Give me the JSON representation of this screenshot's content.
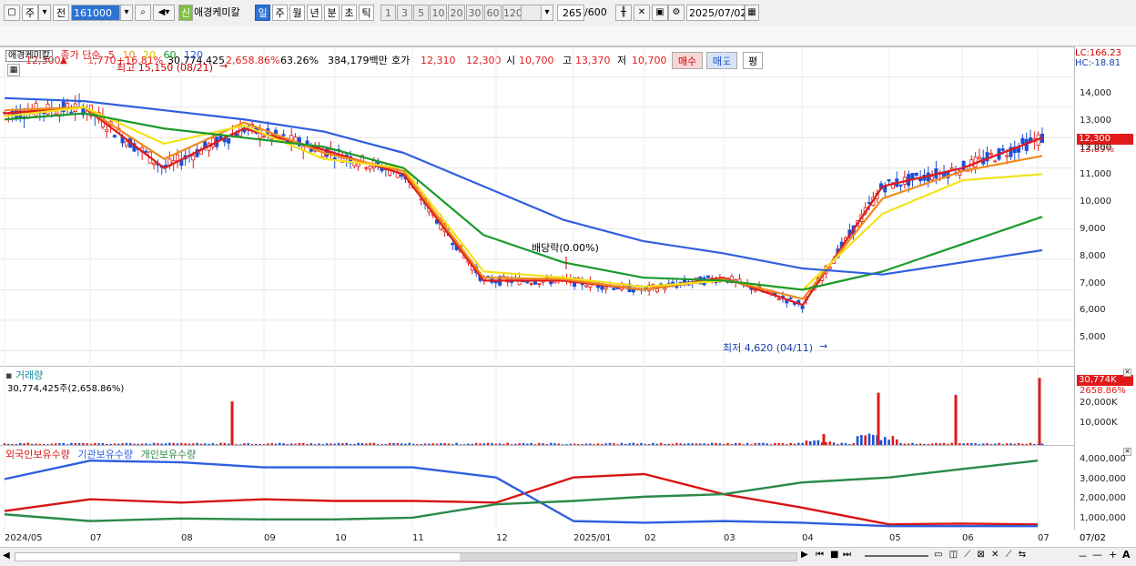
{
  "toolbar": {
    "stock_type": "주",
    "prev_label": "전",
    "code_value": "161000",
    "new_badge": "신",
    "stock_name": "애경케미칼",
    "periods": [
      "일",
      "주",
      "월",
      "년",
      "분",
      "초",
      "틱"
    ],
    "selected_period": "일",
    "minute_buttons": [
      "1",
      "3",
      "5",
      "10",
      "20",
      "30",
      "60",
      "120"
    ],
    "count_value": "265",
    "count_total": "/600",
    "date_value": "2025/07/02"
  },
  "quote": {
    "price": "12,300",
    "arrow": "▲",
    "change": "1,770",
    "change_pct": "+16.81%",
    "volume": "30,774,425",
    "volume_pct": "2,658.86%",
    "rate": "63.26%",
    "amount": "384,179백만",
    "bid_label": "호가",
    "bid1": "12,310",
    "bid2": "12,300",
    "open_label": "시",
    "open": "10,700",
    "high_label": "고",
    "high": "13,370",
    "low_label": "저",
    "low": "10,700",
    "buy_label": "매수",
    "sell_label": "매도",
    "avg_label": "평"
  },
  "price_panel": {
    "name": "애경케미칼",
    "legend_prefix": "종가 단순",
    "ma_periods": [
      "5",
      "10",
      "20",
      "60",
      "120"
    ],
    "high_annotation": "최고 15,150 (08/21)",
    "low_annotation": "최저 4,620 (04/11)",
    "dividend_annotation": "배당락(0.00%)",
    "lc": "LC:166.23",
    "hc": "HC:-18.81",
    "current_price_tag": "12,300",
    "current_pct_tag": "13.89%",
    "y_ticks": [
      "14,000",
      "13,000",
      "12,000",
      "11,000",
      "10,000",
      "9,000",
      "8,000",
      "7,000",
      "6,000",
      "5,000"
    ]
  },
  "volume_panel": {
    "title": "거래량",
    "value_text": "30,774,425주(2,658.86%)",
    "tag_value": "30,774K",
    "tag_pct": "2658.86%",
    "y_ticks": [
      "20,000K",
      "10,000K"
    ]
  },
  "holding_panel": {
    "legend": [
      "외국인보유수량",
      "기관보유수량",
      "개인보유수량"
    ],
    "y_ticks": [
      "4,000,000",
      "3,000,000",
      "2,000,000",
      "1,000,000"
    ]
  },
  "x_axis": {
    "labels": [
      "2024/05",
      "07",
      "08",
      "09",
      "10",
      "11",
      "12",
      "2025/01",
      "02",
      "03",
      "04",
      "05",
      "06",
      "07"
    ],
    "right_label": "07/02"
  },
  "colors": {
    "up": "#e01a1a",
    "down": "#1c4fd6",
    "ma5": "#e01a1a",
    "ma10": "#f08a1c",
    "ma20": "#f3e21a",
    "ma60": "#1a9a2a",
    "ma120": "#2f5fe0",
    "foreign": "#d81414",
    "institution": "#2f5fe0",
    "individual": "#2a8a4a"
  },
  "chart_data": [
    {
      "type": "line",
      "title": "애경케미칼",
      "ylim": [
        4500,
        15000
      ],
      "x": [
        "2024/05",
        "2024/07",
        "2024/08",
        "2024/09",
        "2024/10",
        "2024/11",
        "2024/12",
        "2025/01",
        "2025/02",
        "2025/03",
        "2025/04",
        "2025/05",
        "2025/06",
        "2025/07"
      ],
      "series": [
        {
          "name": "5",
          "values": [
            12800,
            13000,
            11000,
            12300,
            11600,
            10800,
            7300,
            7300,
            7000,
            7400,
            6500,
            10400,
            11000,
            12000
          ]
        },
        {
          "name": "10",
          "values": [
            12900,
            13000,
            11300,
            12500,
            11500,
            10900,
            7400,
            7350,
            7000,
            7350,
            6700,
            10000,
            10900,
            11400
          ]
        },
        {
          "name": "20",
          "values": [
            12700,
            13000,
            11800,
            12400,
            11300,
            11000,
            7600,
            7400,
            7100,
            7300,
            7000,
            9500,
            10600,
            10800
          ]
        },
        {
          "name": "60",
          "values": [
            12600,
            12800,
            12300,
            12000,
            11700,
            11000,
            8800,
            7900,
            7400,
            7300,
            7000,
            7600,
            8500,
            9400
          ]
        },
        {
          "name": "120",
          "values": [
            13300,
            13200,
            12900,
            12600,
            12200,
            11500,
            10400,
            9300,
            8600,
            8200,
            7700,
            7500,
            7900,
            8300
          ]
        }
      ]
    },
    {
      "type": "bar",
      "title": "거래량",
      "x": [
        "2024/08",
        "2025/04",
        "2025/05",
        "2025/06",
        "2025/07"
      ],
      "values": [
        20000,
        5000,
        24000,
        23000,
        30774
      ]
    },
    {
      "type": "line",
      "title": "보유수량",
      "ylim": [
        0,
        4500000
      ],
      "x": [
        "2024/05",
        "2024/07",
        "2024/08",
        "2024/09",
        "2024/10",
        "2024/11",
        "2024/12",
        "2025/01",
        "2025/02",
        "2025/03",
        "2025/04",
        "2025/05",
        "2025/06",
        "2025/07"
      ],
      "series": [
        {
          "name": "외국인보유수량",
          "values": [
            1000000,
            1700000,
            1500000,
            1700000,
            1600000,
            1600000,
            1500000,
            3000000,
            3200000,
            2000000,
            1200000,
            200000,
            250000,
            200000
          ]
        },
        {
          "name": "기관보유수량",
          "values": [
            2900000,
            4000000,
            3900000,
            3600000,
            3600000,
            3600000,
            3000000,
            400000,
            300000,
            400000,
            300000,
            100000,
            100000,
            100000
          ]
        },
        {
          "name": "개인보유수량",
          "values": [
            800000,
            400000,
            550000,
            500000,
            500000,
            600000,
            1400000,
            1600000,
            1850000,
            2000000,
            2700000,
            3000000,
            3500000,
            4000000
          ]
        }
      ]
    }
  ]
}
